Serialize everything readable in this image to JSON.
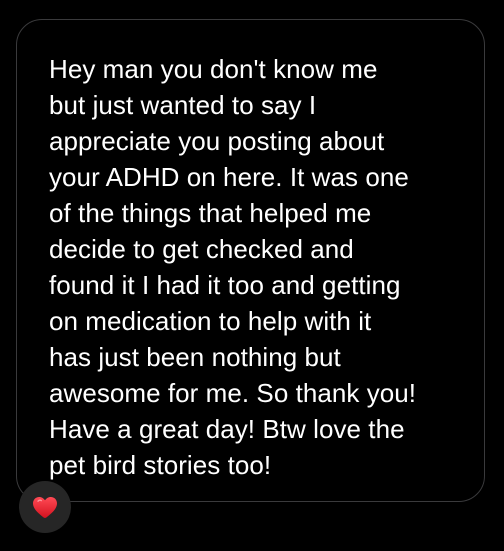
{
  "message": {
    "lines": [
      "Hey man you don't know me",
      "but just wanted to say I",
      "appreciate you posting about",
      "your ADHD on here. It was one",
      "of the things that helped me",
      "decide to get checked and",
      "found it I had it too and getting",
      "on medication to help with it",
      "has just been nothing but",
      "awesome for me. So thank you!",
      "Have a great day! Btw love the",
      "pet bird stories too!"
    ]
  },
  "reaction": {
    "icon": "heart-icon",
    "color": "#e0202e"
  },
  "colors": {
    "background": "#000000",
    "bubble_border": "#3a3a3c",
    "text": "#ffffff",
    "badge_background": "#262626"
  }
}
